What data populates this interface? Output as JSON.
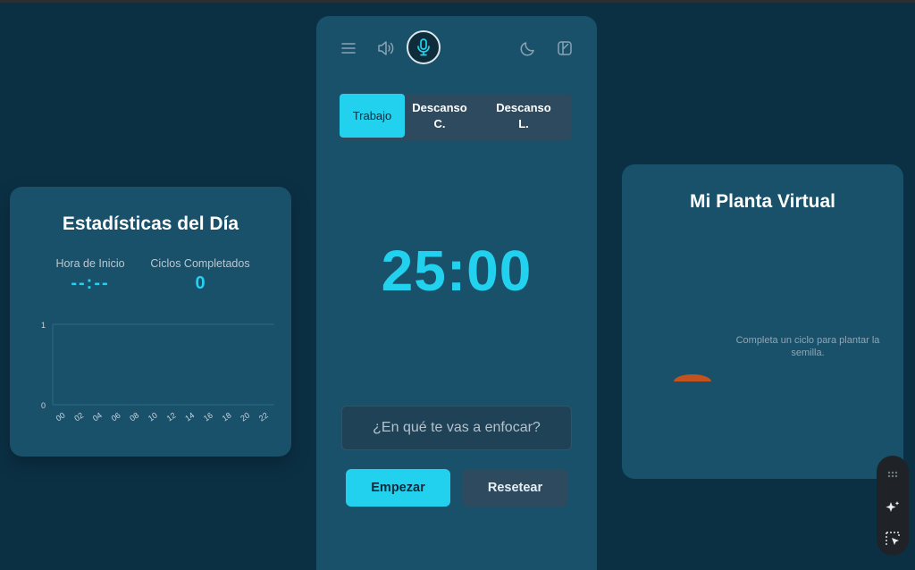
{
  "stats": {
    "title": "Estadísticas del Día",
    "start_label": "Hora de Inicio",
    "start_value": "--:--",
    "cycles_label": "Ciclos Completados",
    "cycles_value": "0",
    "chart": {
      "y_ticks": [
        "1",
        "0"
      ],
      "x_ticks": [
        "00",
        "02",
        "04",
        "06",
        "08",
        "10",
        "12",
        "14",
        "16",
        "18",
        "20",
        "22"
      ]
    }
  },
  "chart_data": {
    "type": "bar",
    "categories": [
      "00",
      "02",
      "04",
      "06",
      "08",
      "10",
      "12",
      "14",
      "16",
      "18",
      "20",
      "22"
    ],
    "values": [
      0,
      0,
      0,
      0,
      0,
      0,
      0,
      0,
      0,
      0,
      0,
      0
    ],
    "title": "",
    "xlabel": "",
    "ylabel": "",
    "ylim": [
      0,
      1
    ],
    "grid": true
  },
  "timer": {
    "tabs": [
      {
        "label": "Trabajo",
        "active": true
      },
      {
        "label": "Descanso C.",
        "active": false
      },
      {
        "label": "Descanso L.",
        "active": false
      }
    ],
    "time": "25:00",
    "focus_placeholder": "¿En qué te vas a enfocar?",
    "start_button": "Empezar",
    "reset_button": "Resetear",
    "icons": [
      "menu-icon",
      "speaker-icon",
      "microphone-icon",
      "moon-icon",
      "theme-palette-icon"
    ]
  },
  "plant": {
    "title": "Mi Planta Virtual",
    "message": "Completa un ciclo para plantar la semilla."
  },
  "toolbar": {
    "icons": [
      "drag-grip-icon",
      "sparkle-icon",
      "select-cursor-icon"
    ]
  },
  "colors": {
    "background": "#0b3044",
    "card": "#19506a",
    "accent": "#22d1ee",
    "muted_button": "#2e4a5e",
    "seed": "#c2531f"
  }
}
